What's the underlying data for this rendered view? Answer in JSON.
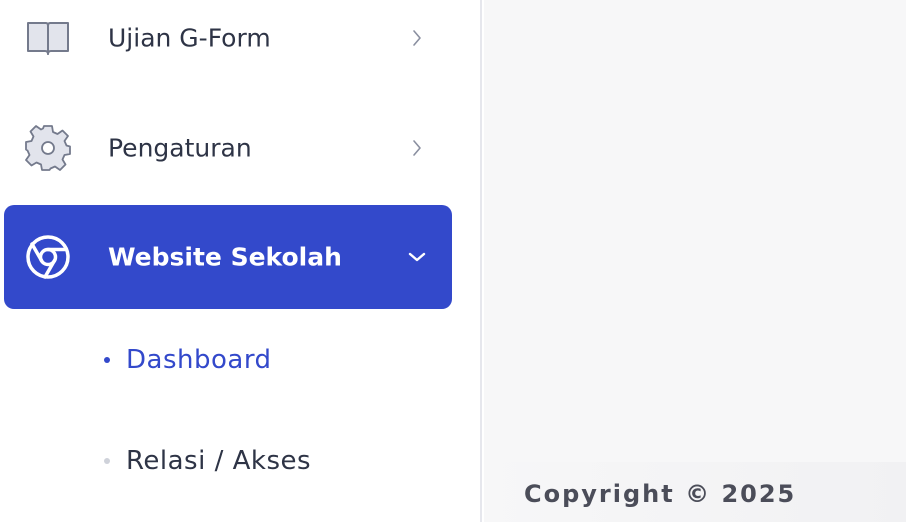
{
  "sidebar": {
    "items": [
      {
        "label": "Ujian G-Form",
        "icon": "book-icon",
        "expanded": false
      },
      {
        "label": "Pengaturan",
        "icon": "gear-icon",
        "expanded": false
      },
      {
        "label": "Website Sekolah",
        "icon": "chrome-icon",
        "expanded": true,
        "active": true
      }
    ],
    "submenu": [
      {
        "label": "Dashboard",
        "active": true
      },
      {
        "label": "Relasi / Akses",
        "active": false
      }
    ]
  },
  "footer": {
    "copyright": "Copyright © 2025"
  },
  "colors": {
    "accent": "#3349cb",
    "text": "#2e3446",
    "content_bg": "#f7f7f8"
  }
}
